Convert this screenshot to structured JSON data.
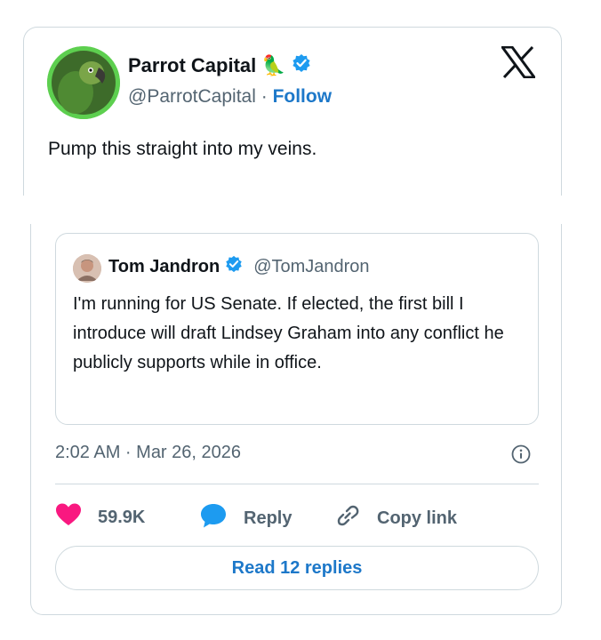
{
  "author": {
    "display_name": "Parrot Capital",
    "emoji": "🦜",
    "handle": "@ParrotCapital",
    "separator": "·",
    "follow_label": "Follow"
  },
  "tweet_text": "Pump this straight into my veins.",
  "quoted": {
    "display_name": "Tom Jandron",
    "handle": "@TomJandron",
    "text": "I'm running for US Senate. If elected, the first bill I introduce will draft Lindsey Graham into any conflict he publicly supports while in office."
  },
  "timestamp": "2:02 AM · Mar 26, 2026",
  "actions": {
    "likes": "59.9K",
    "reply_label": "Reply",
    "copy_label": "Copy link"
  },
  "read_replies_label": "Read 12 replies",
  "colors": {
    "accent": "#1d78c9",
    "verified": "#1d9bf0",
    "like": "#f91880",
    "avatar_ring": "#5dcf4f"
  },
  "icons": {
    "logo": "x-logo-icon",
    "verified": "verified-badge-icon",
    "like": "heart-icon",
    "reply": "speech-bubble-icon",
    "copy": "link-icon",
    "info": "info-icon"
  }
}
